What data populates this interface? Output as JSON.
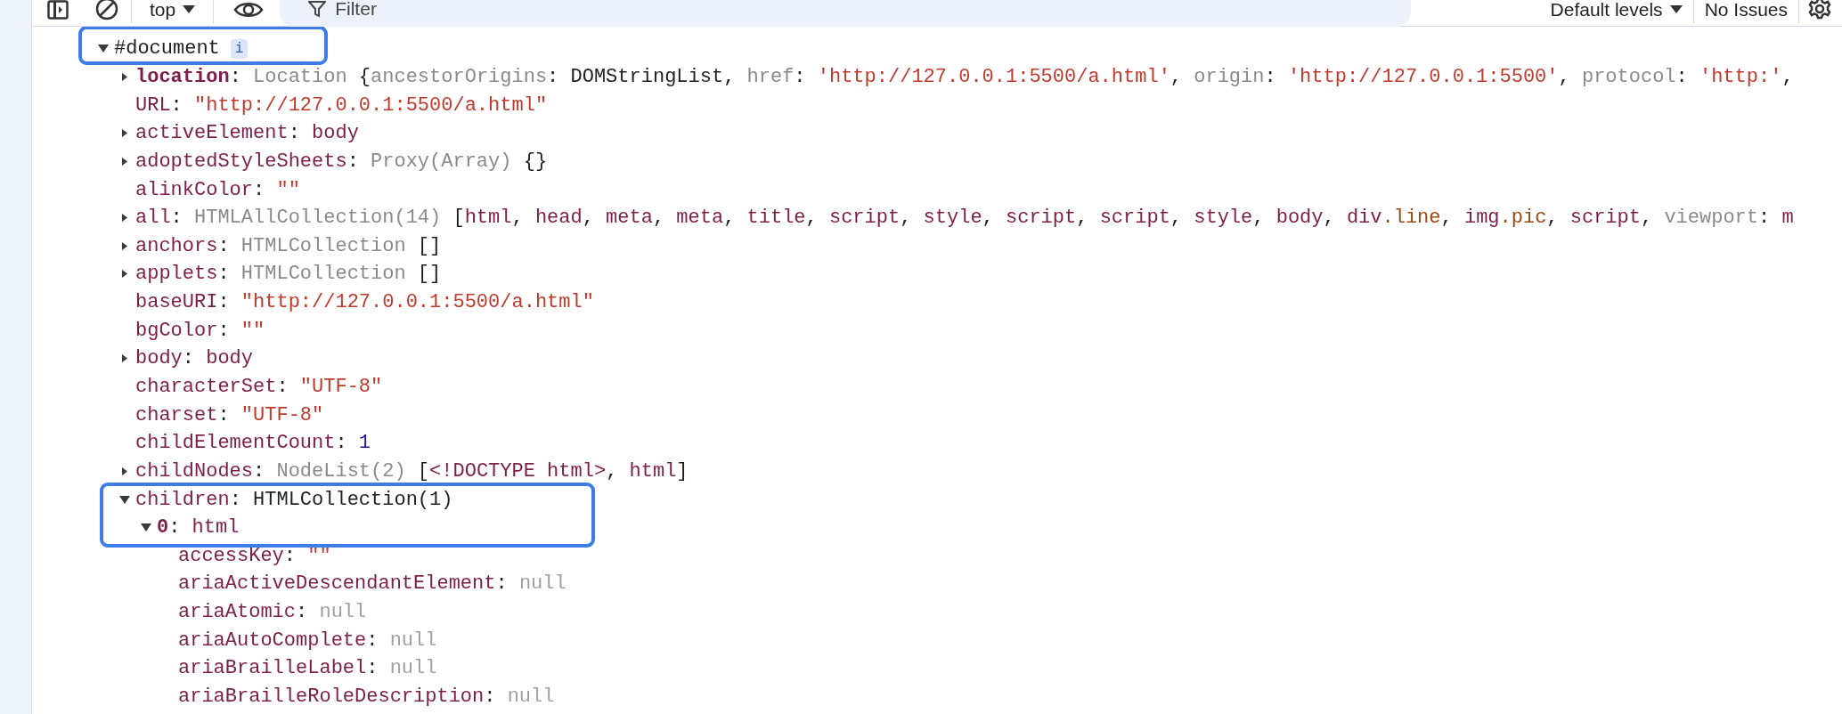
{
  "toolbar": {
    "context": "top",
    "filter_placeholder": "Filter",
    "levels": "Default levels",
    "issues": "No Issues"
  },
  "document": {
    "label": "#document",
    "badge": "i",
    "expandable": true,
    "expanded": true,
    "boxed": true,
    "children": [
      {
        "key": "location",
        "bold": true,
        "expandable": true,
        "expanded": false,
        "boxed": false,
        "value": [
          {
            "text": ": ",
            "kind": "plain"
          },
          {
            "text": "Location",
            "kind": "type"
          },
          {
            "text": " {",
            "kind": "plain"
          },
          {
            "text": "ancestorOrigins",
            "kind": "name"
          },
          {
            "text": ": DOMStringList, ",
            "kind": "plain"
          },
          {
            "text": "href",
            "kind": "name"
          },
          {
            "text": ": ",
            "kind": "plain"
          },
          {
            "text": "'http://127.0.0.1:5500/a.html'",
            "kind": "string"
          },
          {
            "text": ", ",
            "kind": "plain"
          },
          {
            "text": "origin",
            "kind": "name"
          },
          {
            "text": ": ",
            "kind": "plain"
          },
          {
            "text": "'http://127.0.0.1:5500'",
            "kind": "string"
          },
          {
            "text": ", ",
            "kind": "plain"
          },
          {
            "text": "protocol",
            "kind": "name"
          },
          {
            "text": ": ",
            "kind": "plain"
          },
          {
            "text": "'http:'",
            "kind": "string"
          },
          {
            "text": ",",
            "kind": "plain"
          }
        ]
      },
      {
        "key": "URL",
        "bold": false,
        "expandable": false,
        "boxed": false,
        "value": [
          {
            "text": ": ",
            "kind": "plain"
          },
          {
            "text": "\"http://127.0.0.1:5500/a.html\"",
            "kind": "string"
          }
        ]
      },
      {
        "key": "activeElement",
        "bold": false,
        "expandable": true,
        "expanded": false,
        "boxed": false,
        "value": [
          {
            "text": ": ",
            "kind": "plain"
          },
          {
            "text": "body",
            "kind": "element"
          }
        ]
      },
      {
        "key": "adoptedStyleSheets",
        "bold": false,
        "expandable": true,
        "expanded": false,
        "boxed": false,
        "value": [
          {
            "text": ": ",
            "kind": "plain"
          },
          {
            "text": "Proxy(Array)",
            "kind": "type"
          },
          {
            "text": " {}",
            "kind": "plain"
          }
        ]
      },
      {
        "key": "alinkColor",
        "bold": false,
        "expandable": false,
        "boxed": false,
        "value": [
          {
            "text": ": ",
            "kind": "plain"
          },
          {
            "text": "\"\"",
            "kind": "string"
          }
        ]
      },
      {
        "key": "all",
        "bold": false,
        "expandable": true,
        "expanded": false,
        "boxed": false,
        "value": [
          {
            "text": ": ",
            "kind": "plain"
          },
          {
            "text": "HTMLAllCollection(14)",
            "kind": "type"
          },
          {
            "text": " [",
            "kind": "plain"
          },
          {
            "text": "html",
            "kind": "element"
          },
          {
            "text": ", ",
            "kind": "plain"
          },
          {
            "text": "head",
            "kind": "element"
          },
          {
            "text": ", ",
            "kind": "plain"
          },
          {
            "text": "meta",
            "kind": "element"
          },
          {
            "text": ", ",
            "kind": "plain"
          },
          {
            "text": "meta",
            "kind": "element"
          },
          {
            "text": ", ",
            "kind": "plain"
          },
          {
            "text": "title",
            "kind": "element"
          },
          {
            "text": ", ",
            "kind": "plain"
          },
          {
            "text": "script",
            "kind": "element"
          },
          {
            "text": ", ",
            "kind": "plain"
          },
          {
            "text": "style",
            "kind": "element"
          },
          {
            "text": ", ",
            "kind": "plain"
          },
          {
            "text": "script",
            "kind": "element"
          },
          {
            "text": ", ",
            "kind": "plain"
          },
          {
            "text": "script",
            "kind": "element"
          },
          {
            "text": ", ",
            "kind": "plain"
          },
          {
            "text": "style",
            "kind": "element"
          },
          {
            "text": ", ",
            "kind": "plain"
          },
          {
            "text": "body",
            "kind": "element"
          },
          {
            "text": ", ",
            "kind": "plain"
          },
          {
            "text": "div",
            "kind": "element"
          },
          {
            "text": ".line",
            "kind": "class"
          },
          {
            "text": ", ",
            "kind": "plain"
          },
          {
            "text": "img",
            "kind": "element"
          },
          {
            "text": ".pic",
            "kind": "class"
          },
          {
            "text": ", ",
            "kind": "plain"
          },
          {
            "text": "script",
            "kind": "element"
          },
          {
            "text": ", ",
            "kind": "plain"
          },
          {
            "text": "viewport",
            "kind": "name"
          },
          {
            "text": ": ",
            "kind": "plain"
          },
          {
            "text": "m",
            "kind": "element"
          }
        ]
      },
      {
        "key": "anchors",
        "bold": false,
        "expandable": true,
        "expanded": false,
        "boxed": false,
        "value": [
          {
            "text": ": ",
            "kind": "plain"
          },
          {
            "text": "HTMLCollection",
            "kind": "type"
          },
          {
            "text": " []",
            "kind": "plain"
          }
        ]
      },
      {
        "key": "applets",
        "bold": false,
        "expandable": true,
        "expanded": false,
        "boxed": false,
        "value": [
          {
            "text": ": ",
            "kind": "plain"
          },
          {
            "text": "HTMLCollection",
            "kind": "type"
          },
          {
            "text": " []",
            "kind": "plain"
          }
        ]
      },
      {
        "key": "baseURI",
        "bold": false,
        "expandable": false,
        "boxed": false,
        "value": [
          {
            "text": ": ",
            "kind": "plain"
          },
          {
            "text": "\"http://127.0.0.1:5500/a.html\"",
            "kind": "string"
          }
        ]
      },
      {
        "key": "bgColor",
        "bold": false,
        "expandable": false,
        "boxed": false,
        "value": [
          {
            "text": ": ",
            "kind": "plain"
          },
          {
            "text": "\"\"",
            "kind": "string"
          }
        ]
      },
      {
        "key": "body",
        "bold": false,
        "expandable": true,
        "expanded": false,
        "boxed": false,
        "value": [
          {
            "text": ": ",
            "kind": "plain"
          },
          {
            "text": "body",
            "kind": "element"
          }
        ]
      },
      {
        "key": "characterSet",
        "bold": false,
        "expandable": false,
        "boxed": false,
        "value": [
          {
            "text": ": ",
            "kind": "plain"
          },
          {
            "text": "\"UTF-8\"",
            "kind": "string"
          }
        ]
      },
      {
        "key": "charset",
        "bold": false,
        "expandable": false,
        "boxed": false,
        "value": [
          {
            "text": ": ",
            "kind": "plain"
          },
          {
            "text": "\"UTF-8\"",
            "kind": "string"
          }
        ]
      },
      {
        "key": "childElementCount",
        "bold": false,
        "expandable": false,
        "boxed": false,
        "value": [
          {
            "text": ": ",
            "kind": "plain"
          },
          {
            "text": "1",
            "kind": "number"
          }
        ]
      },
      {
        "key": "childNodes",
        "bold": false,
        "expandable": true,
        "expanded": false,
        "boxed": false,
        "value": [
          {
            "text": ": ",
            "kind": "plain"
          },
          {
            "text": "NodeList(2)",
            "kind": "type"
          },
          {
            "text": " [",
            "kind": "plain"
          },
          {
            "text": "<!DOCTYPE html>",
            "kind": "element"
          },
          {
            "text": ", ",
            "kind": "plain"
          },
          {
            "text": "html",
            "kind": "element"
          },
          {
            "text": "]",
            "kind": "plain"
          }
        ]
      },
      {
        "key": "children",
        "bold": false,
        "expandable": true,
        "expanded": true,
        "boxed": true,
        "value": [
          {
            "text": ": ",
            "kind": "plain"
          },
          {
            "text": "HTMLCollection(1)",
            "kind": "plain"
          }
        ],
        "children": [
          {
            "key": "0",
            "bold": true,
            "expandable": true,
            "expanded": true,
            "boxed": true,
            "value": [
              {
                "text": ": ",
                "kind": "plain"
              },
              {
                "text": "html",
                "kind": "element"
              }
            ],
            "children": [
              {
                "key": "accessKey",
                "bold": false,
                "expandable": false,
                "boxed": false,
                "value": [
                  {
                    "text": ": ",
                    "kind": "plain"
                  },
                  {
                    "text": "\"\"",
                    "kind": "string"
                  }
                ]
              },
              {
                "key": "ariaActiveDescendantElement",
                "bold": false,
                "expandable": false,
                "boxed": false,
                "value": [
                  {
                    "text": ": ",
                    "kind": "plain"
                  },
                  {
                    "text": "null",
                    "kind": "null"
                  }
                ]
              },
              {
                "key": "ariaAtomic",
                "bold": false,
                "expandable": false,
                "boxed": false,
                "value": [
                  {
                    "text": ": ",
                    "kind": "plain"
                  },
                  {
                    "text": "null",
                    "kind": "null"
                  }
                ]
              },
              {
                "key": "ariaAutoComplete",
                "bold": false,
                "expandable": false,
                "boxed": false,
                "value": [
                  {
                    "text": ": ",
                    "kind": "plain"
                  },
                  {
                    "text": "null",
                    "kind": "null"
                  }
                ]
              },
              {
                "key": "ariaBrailleLabel",
                "bold": false,
                "expandable": false,
                "boxed": false,
                "value": [
                  {
                    "text": ": ",
                    "kind": "plain"
                  },
                  {
                    "text": "null",
                    "kind": "null"
                  }
                ]
              },
              {
                "key": "ariaBrailleRoleDescription",
                "bold": false,
                "expandable": false,
                "boxed": false,
                "value": [
                  {
                    "text": ": ",
                    "kind": "plain"
                  },
                  {
                    "text": "null",
                    "kind": "null"
                  }
                ]
              }
            ]
          }
        ]
      }
    ]
  }
}
